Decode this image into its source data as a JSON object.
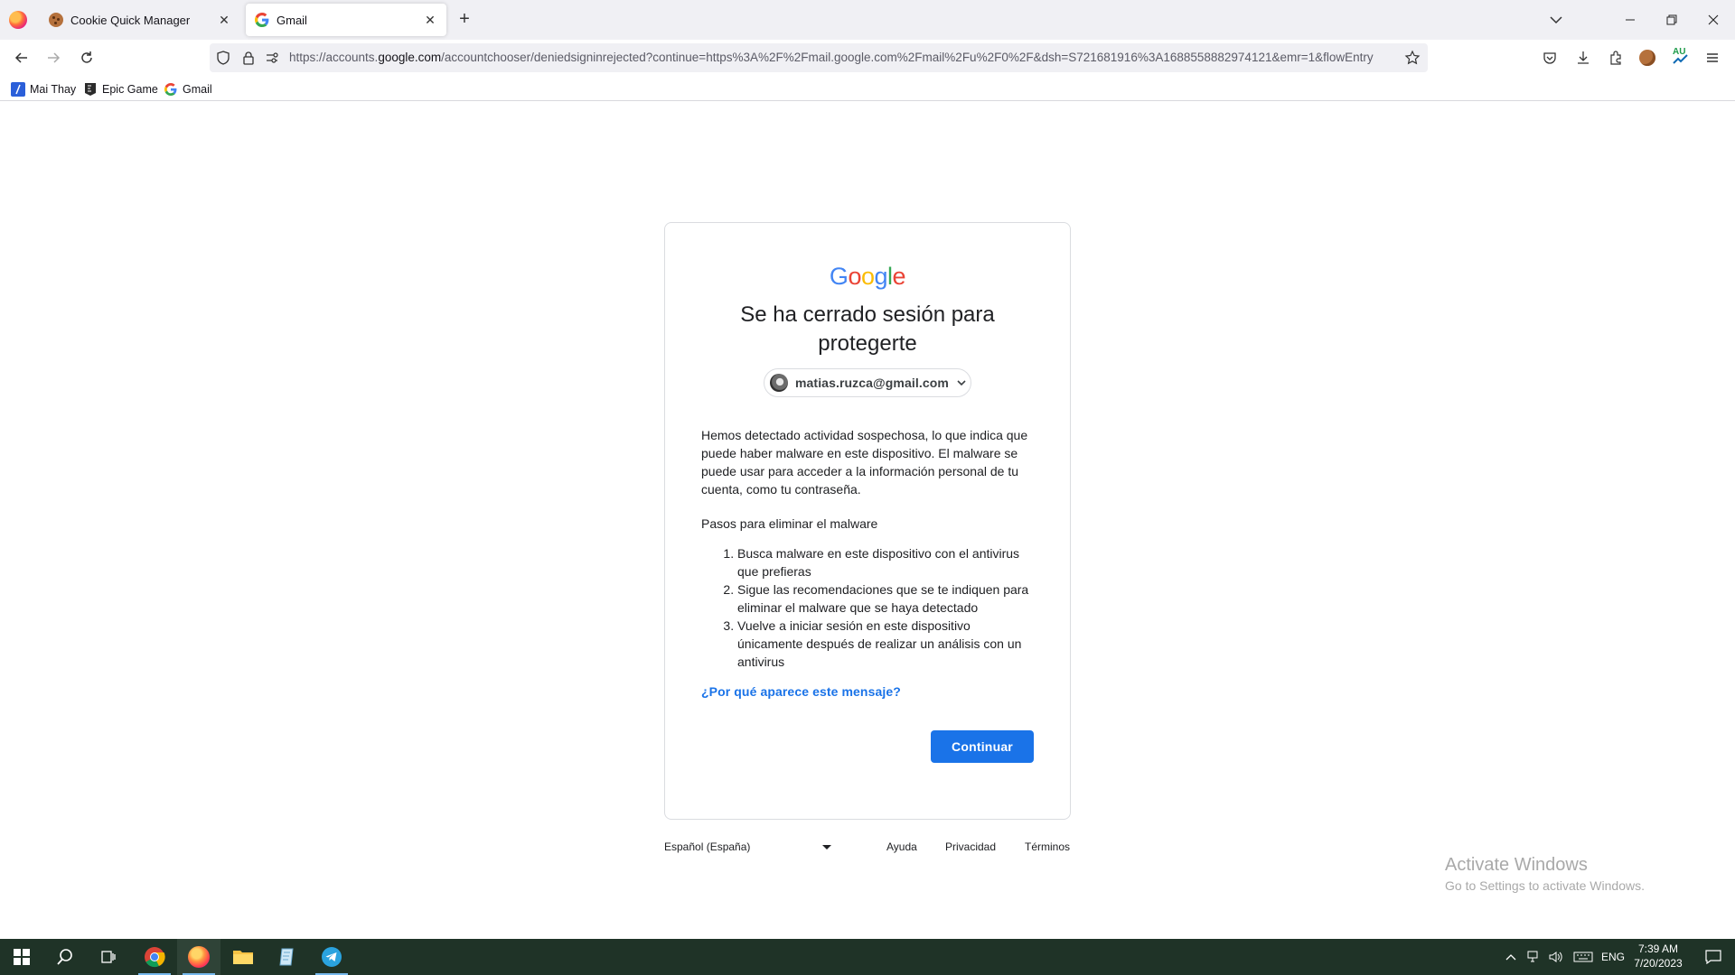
{
  "browser": {
    "tabs": [
      {
        "title": "Cookie Quick Manager",
        "favicon": "cookie-icon",
        "active": false
      },
      {
        "title": "Gmail",
        "favicon": "google-g-icon",
        "active": true
      }
    ],
    "url": {
      "prefix": "https://accounts.",
      "host": "google.com",
      "path": "/accountchooser/deniedsigninrejected?continue=https%3A%2F%2Fmail.google.com%2Fmail%2Fu%2F0%2F&dsh=S721681916%3A1688558882974121&emr=1&flowEntry"
    },
    "bookmarks": [
      {
        "label": "Mai Thay",
        "icon": "slash-icon"
      },
      {
        "label": "Epic Game",
        "icon": "epic-games-icon"
      },
      {
        "label": "Gmail",
        "icon": "google-g-icon"
      }
    ],
    "extension_badge": "AU"
  },
  "page": {
    "logo": "Google",
    "heading": "Se ha cerrado sesión para protegerte",
    "account_email": "matias.ruzca@gmail.com",
    "body": "Hemos detectado actividad sospechosa, lo que indica que puede haber malware en este dispositivo. El malware se puede usar para acceder a la información personal de tu cuenta, como tu contraseña.",
    "steps_title": "Pasos para eliminar el malware",
    "steps": [
      "Busca malware en este dispositivo con el antivirus que prefieras",
      "Sigue las recomendaciones que se te indiquen para eliminar el malware que se haya detectado",
      "Vuelve a iniciar sesión en este dispositivo únicamente después de realizar un análisis con un antivirus"
    ],
    "why_link": "¿Por qué aparece este mensaje?",
    "continue_button": "Continuar"
  },
  "footer": {
    "language": "Español (España)",
    "links": [
      "Ayuda",
      "Privacidad",
      "Términos"
    ]
  },
  "watermark": {
    "title": "Activate Windows",
    "subtitle": "Go to Settings to activate Windows."
  },
  "taskbar": {
    "language": "ENG",
    "time": "7:39 AM",
    "date": "7/20/2023"
  },
  "colors": {
    "google_blue": "#4285F4",
    "google_red": "#EA4335",
    "google_yellow": "#FBBC05",
    "google_green": "#34A853",
    "primary_button": "#1a73e8",
    "taskbar": "#1f3327"
  }
}
